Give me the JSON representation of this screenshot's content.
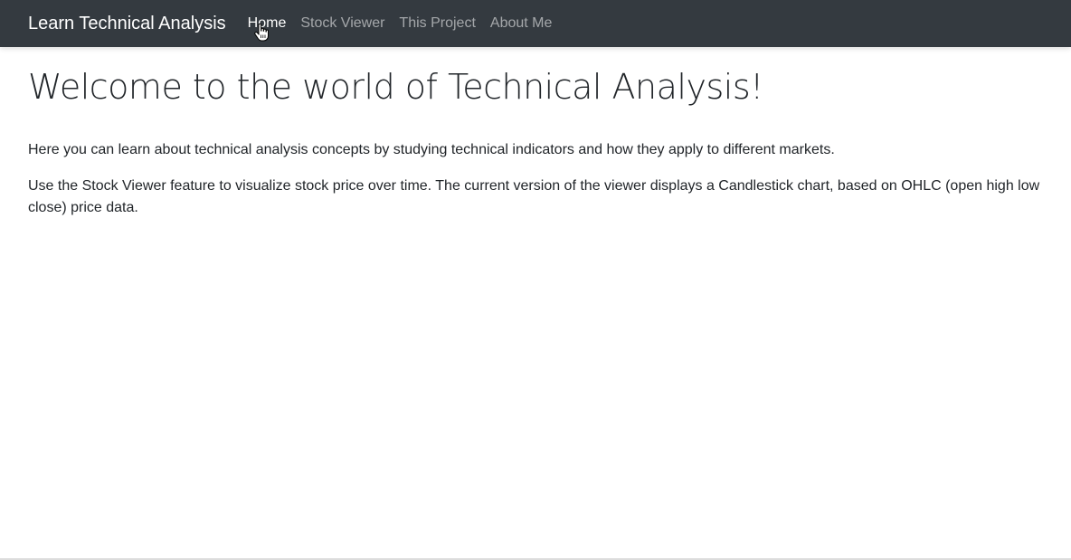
{
  "navbar": {
    "brand": "Learn Technical Analysis",
    "links": [
      {
        "label": "Home",
        "active": true
      },
      {
        "label": "Stock Viewer",
        "active": false
      },
      {
        "label": "This Project",
        "active": false
      },
      {
        "label": "About Me",
        "active": false
      }
    ]
  },
  "main": {
    "title": "Welcome to the world of Technical Analysis!",
    "paragraphs": [
      "Here you can learn about technical analysis concepts by studying technical indicators and how they apply to different markets.",
      "Use the Stock Viewer feature to visualize stock price over time. The current version of the viewer displays a Candlestick chart, based on OHLC (open high low close) price data."
    ]
  },
  "colors": {
    "navbar_bg": "#343a40",
    "nav_active": "#ffffff",
    "nav_inactive": "rgba(255,255,255,0.55)",
    "text": "#212529"
  },
  "icons": {
    "cursor": "hand-pointer-cursor-icon"
  }
}
